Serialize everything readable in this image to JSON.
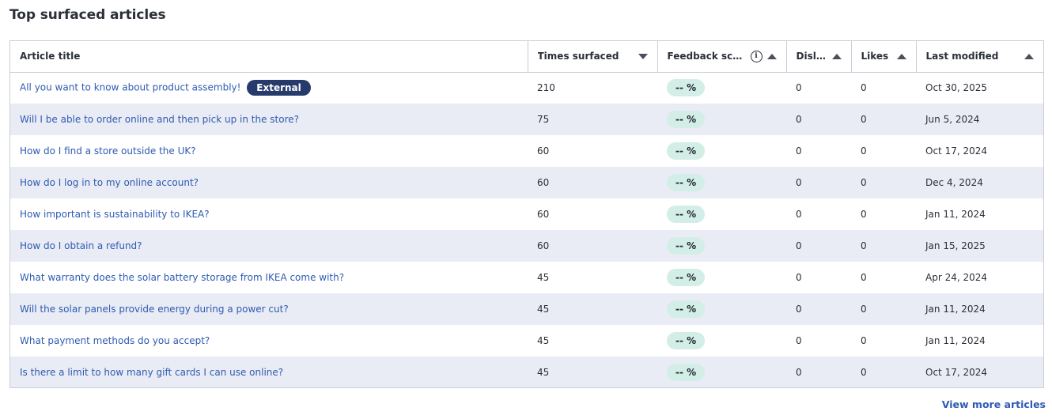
{
  "page": {
    "title": "Top surfaced articles",
    "view_more": "View more articles"
  },
  "colors": {
    "link": "#2f5ab3",
    "badge_bg": "#263a6b",
    "score_pill_bg": "#d3eee6",
    "zebra_row": "#e9ecf4",
    "border": "#c9cdd6"
  },
  "table": {
    "columns": [
      {
        "label": "Article title",
        "sort": "none"
      },
      {
        "label": "Times surfaced",
        "sort": "descending",
        "sort_icon": "caret-down-icon"
      },
      {
        "label": "Feedback score",
        "sort": "ascending",
        "sort_icon": "caret-up-icon",
        "info_icon": "info-icon"
      },
      {
        "label": "Disli...",
        "sort": "ascending",
        "sort_icon": "caret-up-icon"
      },
      {
        "label": "Likes",
        "sort": "ascending",
        "sort_icon": "caret-up-icon"
      },
      {
        "label": "Last modified",
        "sort": "ascending",
        "sort_icon": "caret-up-icon"
      }
    ],
    "rows": [
      {
        "title": "All you want to know about product assembly!",
        "badge": "External",
        "times": "210",
        "score": "-- %",
        "dislikes": "0",
        "likes": "0",
        "modified": "Oct 30, 2025"
      },
      {
        "title": "Will I be able to order online and then pick up in the store?",
        "badge": "",
        "times": "75",
        "score": "-- %",
        "dislikes": "0",
        "likes": "0",
        "modified": "Jun 5, 2024"
      },
      {
        "title": "How do I find a store outside the UK?",
        "badge": "",
        "times": "60",
        "score": "-- %",
        "dislikes": "0",
        "likes": "0",
        "modified": "Oct 17, 2024"
      },
      {
        "title": "How do I log in to my online account?",
        "badge": "",
        "times": "60",
        "score": "-- %",
        "dislikes": "0",
        "likes": "0",
        "modified": "Dec 4, 2024"
      },
      {
        "title": "How important is sustainability to IKEA?",
        "badge": "",
        "times": "60",
        "score": "-- %",
        "dislikes": "0",
        "likes": "0",
        "modified": "Jan 11, 2024"
      },
      {
        "title": "How do I obtain a refund?",
        "badge": "",
        "times": "60",
        "score": "-- %",
        "dislikes": "0",
        "likes": "0",
        "modified": "Jan 15, 2025"
      },
      {
        "title": "What warranty does the solar battery storage from IKEA come with?",
        "badge": "",
        "times": "45",
        "score": "-- %",
        "dislikes": "0",
        "likes": "0",
        "modified": "Apr 24, 2024"
      },
      {
        "title": "Will the solar panels provide energy during a power cut?",
        "badge": "",
        "times": "45",
        "score": "-- %",
        "dislikes": "0",
        "likes": "0",
        "modified": "Jan 11, 2024"
      },
      {
        "title": "What payment methods do you accept?",
        "badge": "",
        "times": "45",
        "score": "-- %",
        "dislikes": "0",
        "likes": "0",
        "modified": "Jan 11, 2024"
      },
      {
        "title": "Is there a limit to how many gift cards I can use online?",
        "badge": "",
        "times": "45",
        "score": "-- %",
        "dislikes": "0",
        "likes": "0",
        "modified": "Oct 17, 2024"
      }
    ]
  }
}
